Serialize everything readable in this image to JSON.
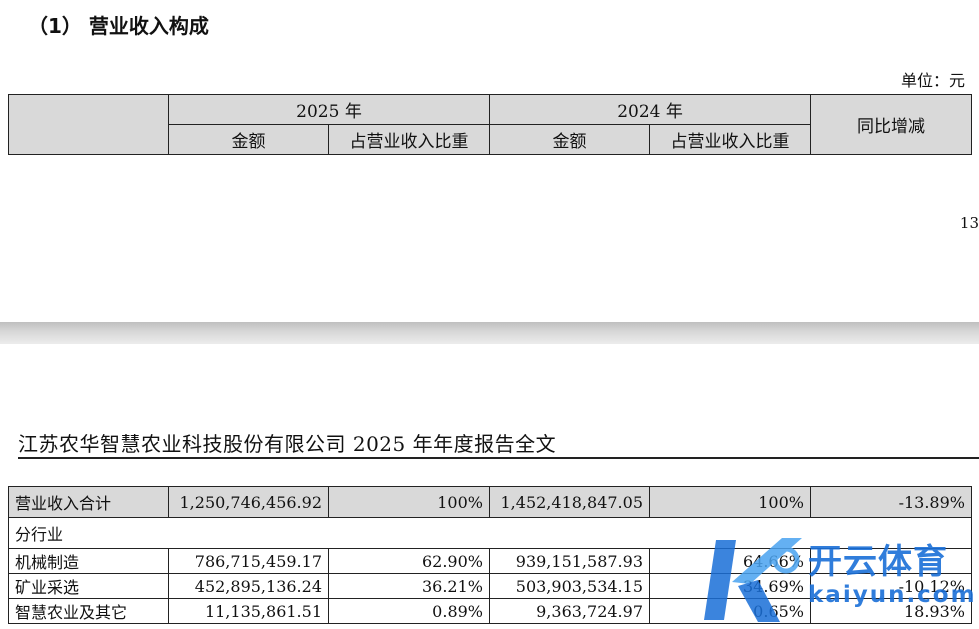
{
  "section_title": "（1） 营业收入构成",
  "unit_label": "单位：元",
  "header": {
    "year_2025": "2025 年",
    "year_2024": "2024 年",
    "amount": "金额",
    "share": "占营业收入比重",
    "yoy": "同比增减"
  },
  "cut_number": "13",
  "doc_header": "江苏农华智慧农业科技股份有限公司 2025 年年度报告全文",
  "rows": [
    {
      "label": "营业收入合计",
      "amt2025": "1,250,746,456.92",
      "pct2025": "100%",
      "amt2024": "1,452,418,847.05",
      "pct2024": "100%",
      "yoy": "-13.89%"
    },
    {
      "label": "分行业"
    },
    {
      "label": "机械制造",
      "amt2025": "786,715,459.17",
      "pct2025": "62.90%",
      "amt2024": "939,151,587.93",
      "pct2024": "64.66%",
      "yoy": ""
    },
    {
      "label": "矿业采选",
      "amt2025": "452,895,136.24",
      "pct2025": "36.21%",
      "amt2024": "503,903,534.15",
      "pct2024": "34.69%",
      "yoy": "-10.12%"
    },
    {
      "label": "智慧农业及其它",
      "amt2025": "11,135,861.51",
      "pct2025": "0.89%",
      "amt2024": "9,363,724.97",
      "pct2024": "0.65%",
      "yoy": "18.93%"
    }
  ],
  "watermark": {
    "line1": "开云体育",
    "line2": "kaiyun.com",
    "color": "#1a6fd8"
  }
}
